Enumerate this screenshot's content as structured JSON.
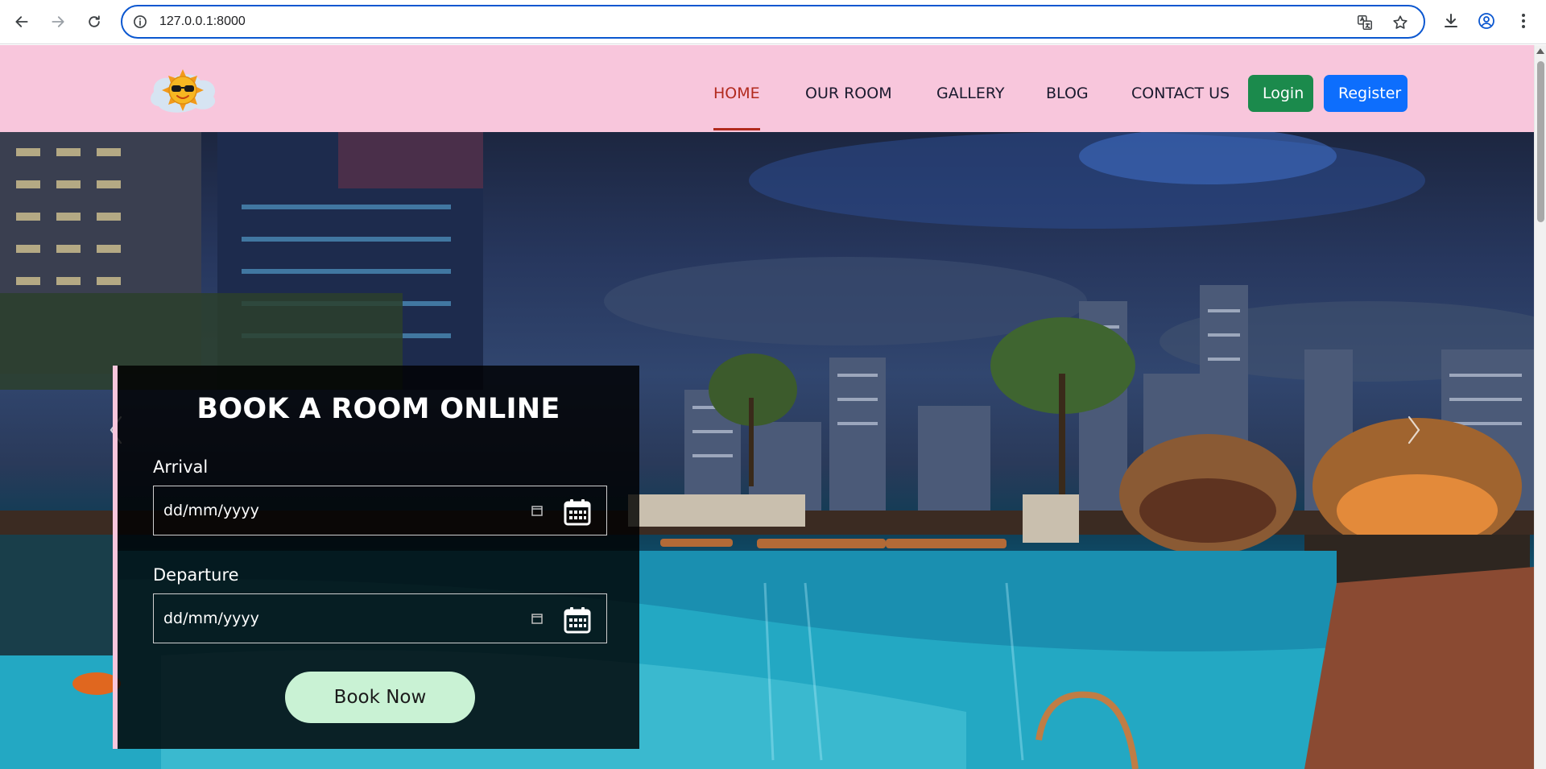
{
  "browser": {
    "url": "127.0.0.1:8000"
  },
  "header": {
    "logo_icon": "sun-with-sunglasses-icon",
    "nav": [
      "HOME",
      "OUR ROOM",
      "GALLERY",
      "BLOG",
      "CONTACT US"
    ],
    "active_nav": "HOME",
    "login_label": "Login",
    "register_label": "Register",
    "colors": {
      "header_bg": "#f8c6dc",
      "active": "#b22a1e",
      "login_bg": "#1b8a4c",
      "register_bg": "#0d6efd"
    }
  },
  "booking": {
    "title": "BOOK A ROOM ONLINE",
    "arrival_label": "Arrival",
    "arrival_placeholder": "dd/mm/yyyy",
    "departure_label": "Departure",
    "departure_placeholder": "dd/mm/yyyy",
    "submit_label": "Book Now",
    "colors": {
      "panel_accent": "#f8c6dc",
      "button_bg": "#c9f2d4"
    }
  },
  "hero": {
    "image": "rooftop-pool-city-night",
    "prev_icon": "chevron-left-icon",
    "next_icon": "chevron-right-icon"
  }
}
